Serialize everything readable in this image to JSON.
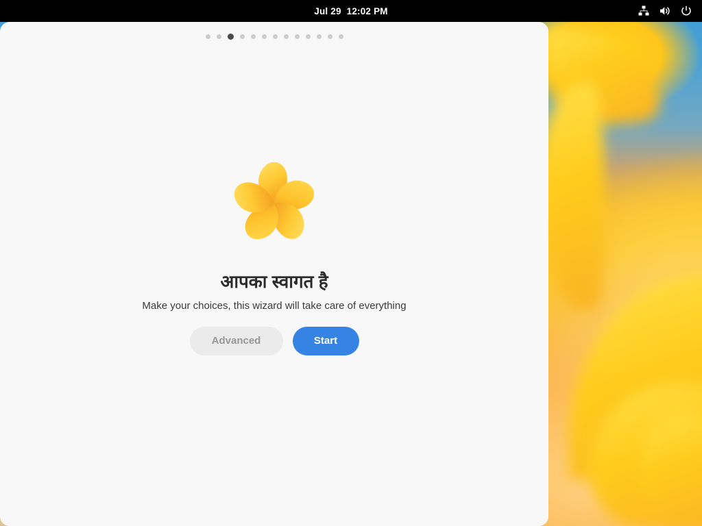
{
  "topbar": {
    "clock": "Jul 29  12:02 PM",
    "tray": [
      {
        "name": "network-wired-icon",
        "label": "Wired network"
      },
      {
        "name": "volume-icon",
        "label": "Volume"
      },
      {
        "name": "power-icon",
        "label": "Power"
      }
    ]
  },
  "installer": {
    "pagination": {
      "total": 13,
      "active_index": 3
    },
    "logo": {
      "name": "flower-logo",
      "petal_count": 5,
      "colors": {
        "petal_light": "#ffdd55",
        "petal_mid": "#ffc730",
        "petal_dark": "#f5a623"
      }
    },
    "title": "आपका स्वागत है",
    "subtitle": "Make your choices, this wizard will take care of everything",
    "buttons": {
      "advanced": "Advanced",
      "start": "Start"
    }
  },
  "colors": {
    "accent": "#3584e4",
    "card_background": "#f8f8f8",
    "topbar_background": "#000000",
    "secondary_button": "#ebebeb",
    "secondary_button_text": "#979797",
    "dot_inactive": "#cdcdcd",
    "dot_active": "#4a4a4a"
  }
}
